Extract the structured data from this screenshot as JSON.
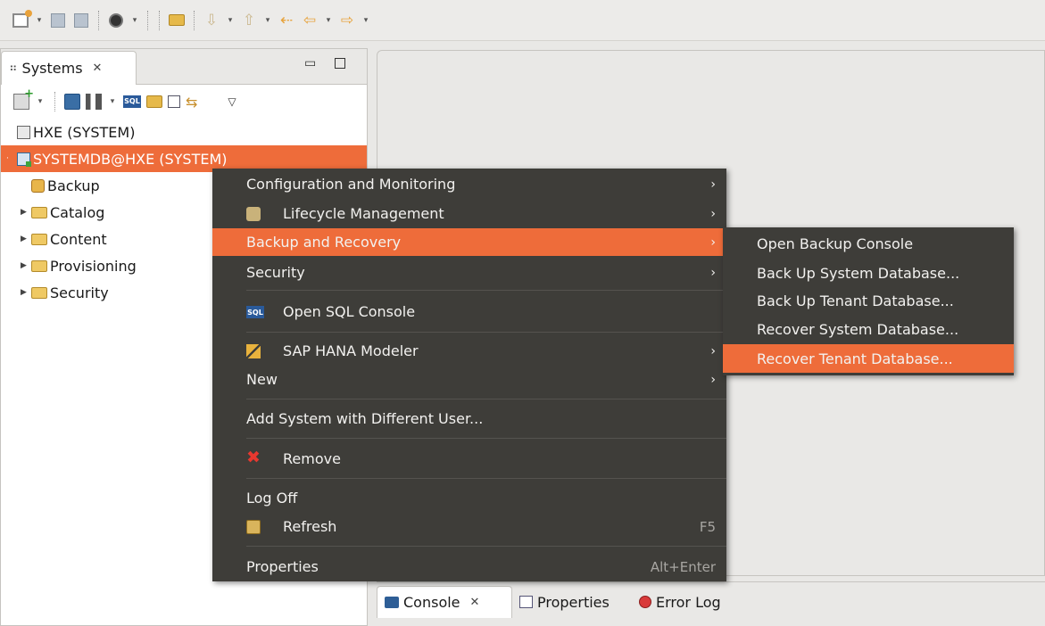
{
  "systems_view": {
    "tab_label": "Systems",
    "tab_close_glyph": "✕",
    "minimize_glyph": "▭",
    "view_menu_glyph": "▽"
  },
  "tree": {
    "nodes": [
      {
        "label": "HXE (SYSTEM)"
      },
      {
        "label": "SYSTEMDB@HXE (SYSTEM)",
        "selected": true
      },
      {
        "label": "Backup"
      },
      {
        "label": "Catalog"
      },
      {
        "label": "Content"
      },
      {
        "label": "Provisioning"
      },
      {
        "label": "Security"
      }
    ]
  },
  "context_menu": {
    "items": [
      {
        "label": "Configuration and Monitoring",
        "submenu": true
      },
      {
        "label": "Lifecycle Management",
        "icon": "lifecycle-icon",
        "submenu": true
      },
      {
        "label": "Backup and Recovery",
        "submenu": true,
        "highlighted": true
      },
      {
        "label": "Security",
        "submenu": true
      },
      {
        "label": "Open SQL Console",
        "icon": "sql-console-icon"
      },
      {
        "label": "SAP HANA Modeler",
        "icon": "modeler-icon",
        "submenu": true
      },
      {
        "label": "New",
        "submenu": true
      },
      {
        "label": "Add System with Different User..."
      },
      {
        "label": "Remove",
        "icon": "remove-icon"
      },
      {
        "label": "Log Off"
      },
      {
        "label": "Refresh",
        "icon": "refresh-icon",
        "accelerator": "F5"
      },
      {
        "label": "Properties",
        "accelerator": "Alt+Enter"
      }
    ],
    "arrow_glyph": "›",
    "sql_icon_text": "SQL"
  },
  "submenu": {
    "items": [
      {
        "label": "Open Backup Console"
      },
      {
        "label": "Back Up System Database..."
      },
      {
        "label": "Back Up Tenant Database..."
      },
      {
        "label": "Recover System Database..."
      },
      {
        "label": "Recover Tenant Database...",
        "highlighted": true
      }
    ]
  },
  "bottom_tabs": {
    "console": "Console",
    "console_close_glyph": "✕",
    "properties": "Properties",
    "error_log": "Error Log"
  },
  "toolbar": {
    "caret_glyph": "▾",
    "back_glyph": "⇦",
    "forward_glyph": "⇨",
    "last_edit_glyph": "⇠",
    "next_annotation_glyph": "⇩",
    "prev_annotation_glyph": "⇧"
  },
  "colors": {
    "selection": "#ee6c3a",
    "menu_background": "#3e3d39",
    "menu_text": "#f2f1ef"
  }
}
